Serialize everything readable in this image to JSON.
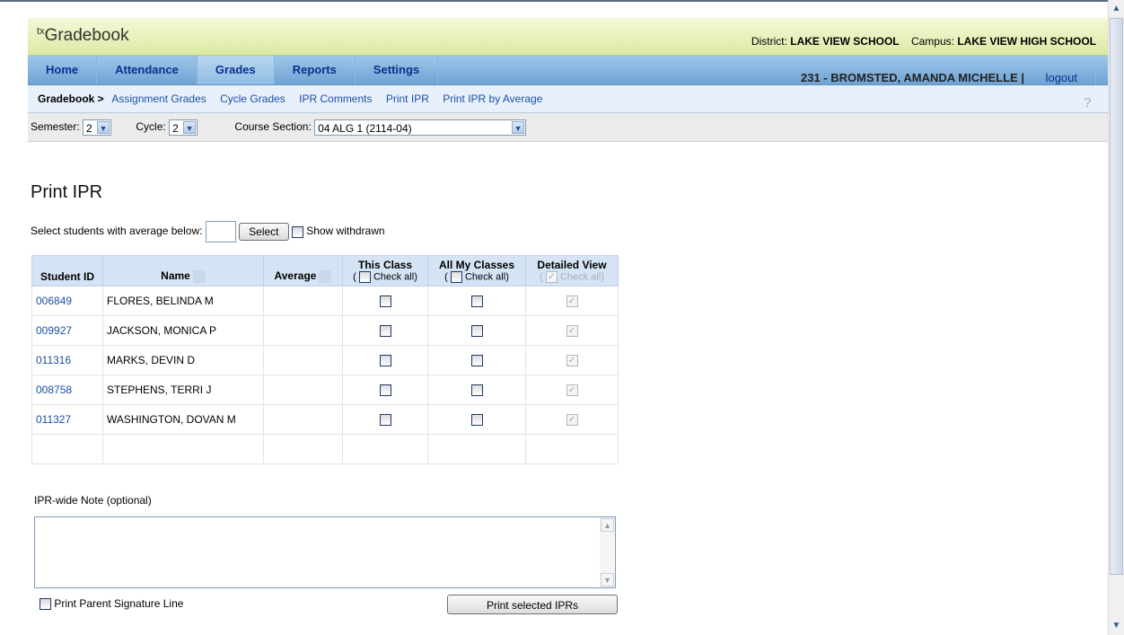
{
  "app": {
    "logo_prefix": "tx",
    "logo_text": "Gradebook"
  },
  "header": {
    "district_label": "District:",
    "district": "LAKE VIEW SCHOOL",
    "campus_label": "Campus:",
    "campus": "LAKE VIEW HIGH SCHOOL"
  },
  "nav": {
    "tabs": [
      "Home",
      "Attendance",
      "Grades",
      "Reports",
      "Settings"
    ],
    "active": "Grades",
    "user": "231 - BROMSTED, AMANDA MICHELLE",
    "logout": "logout"
  },
  "subnav": {
    "lead": "Gradebook >",
    "links": [
      "Assignment Grades",
      "Cycle Grades",
      "IPR Comments",
      "Print IPR",
      "Print IPR by Average"
    ]
  },
  "filters": {
    "semester_label": "Semester:",
    "semester": "2",
    "cycle_label": "Cycle:",
    "cycle": "2",
    "course_label": "Course Section:",
    "course": "04 ALG 1 (2114-04)"
  },
  "page": {
    "title": "Print IPR",
    "avg_label": "Select students with average below:",
    "select_btn": "Select",
    "show_withdrawn": "Show withdrawn"
  },
  "table": {
    "headers": {
      "id": "Student ID",
      "name": "Name",
      "avg": "Average",
      "this_class": "This Class",
      "all_classes": "All My Classes",
      "detailed": "Detailed View",
      "check_all": "Check all"
    },
    "rows": [
      {
        "id": "006849",
        "name": "FLORES, BELINDA M"
      },
      {
        "id": "009927",
        "name": "JACKSON, MONICA P"
      },
      {
        "id": "011316",
        "name": "MARKS, DEVIN D"
      },
      {
        "id": "008758",
        "name": "STEPHENS, TERRI J"
      },
      {
        "id": "011327",
        "name": "WASHINGTON, DOVAN M"
      }
    ]
  },
  "note": {
    "label": "IPR-wide Note (optional)"
  },
  "footer": {
    "signature": "Print Parent Signature Line",
    "print_btn": "Print selected IPRs"
  }
}
